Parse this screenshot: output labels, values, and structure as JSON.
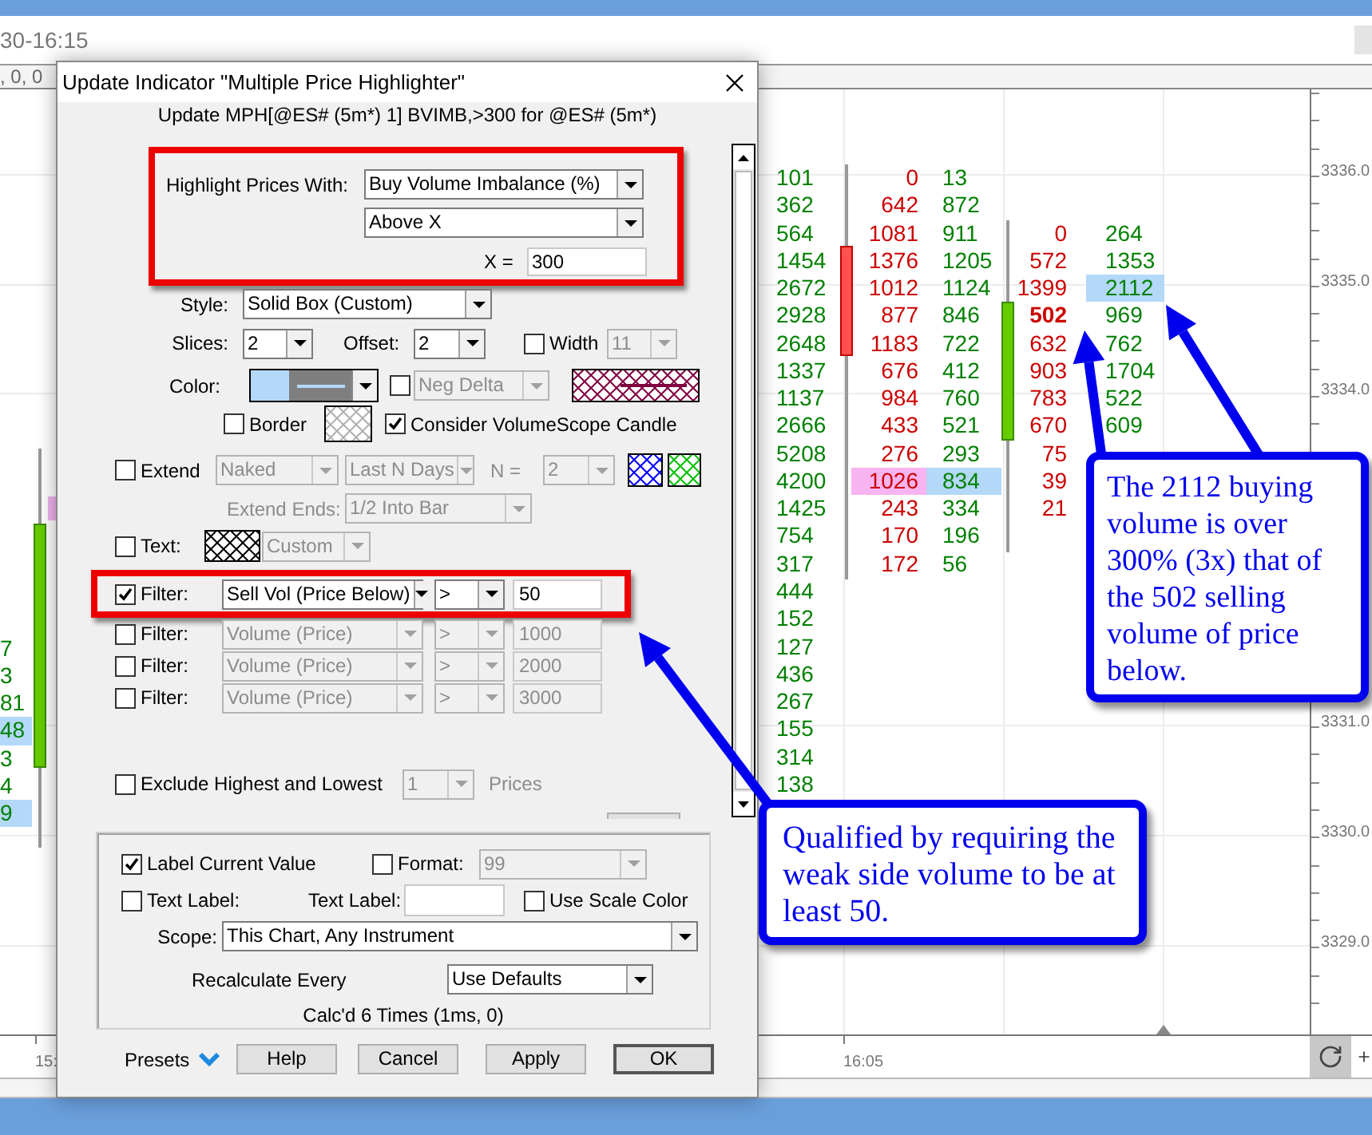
{
  "chart": {
    "range": "30-16:15",
    "status": ", 0, 0",
    "price_labels": [
      "3336.0",
      "3335.0",
      "3334.0",
      "3331.0",
      "3330.0",
      "3329.0"
    ],
    "time_labels": [
      "15:",
      "16:05"
    ],
    "left_cells": [
      {
        "text": "7",
        "highlighted": false
      },
      {
        "text": "3",
        "highlighted": false
      },
      {
        "text": "81",
        "highlighted": false
      },
      {
        "text": "48",
        "highlighted": true
      },
      {
        "text": "3",
        "highlighted": false
      },
      {
        "text": "4",
        "highlighted": false
      },
      {
        "text": "9",
        "highlighted": true
      }
    ],
    "volume_column": [
      "101",
      "362",
      "564",
      "1454",
      "2672",
      "2928",
      "2648",
      "1337",
      "1137",
      "2666",
      "5208",
      "4200",
      "1425",
      "754",
      "317",
      "444",
      "152",
      "127",
      "436",
      "267",
      "155",
      "314",
      "138"
    ],
    "footprints": [
      {
        "rows": [
          {
            "sell": "0",
            "buy": "13",
            "highlighted": false
          },
          {
            "sell": "642",
            "buy": "872",
            "highlighted": false
          },
          {
            "sell": "1081",
            "buy": "911",
            "highlighted": false
          },
          {
            "sell": "1376",
            "buy": "1205",
            "highlighted": false
          },
          {
            "sell": "1012",
            "buy": "1124",
            "highlighted": false
          },
          {
            "sell": "877",
            "buy": "846",
            "highlighted": false
          },
          {
            "sell": "1183",
            "buy": "722",
            "highlighted": false
          },
          {
            "sell": "676",
            "buy": "412",
            "highlighted": false
          },
          {
            "sell": "984",
            "buy": "760",
            "highlighted": false
          },
          {
            "sell": "433",
            "buy": "521",
            "highlighted": false
          },
          {
            "sell": "276",
            "buy": "293",
            "highlighted": false
          },
          {
            "sell": "1026",
            "buy": "834",
            "highlighted": true
          },
          {
            "sell": "243",
            "buy": "334",
            "highlighted": false
          },
          {
            "sell": "170",
            "buy": "196",
            "highlighted": false
          },
          {
            "sell": "172",
            "buy": "56",
            "highlighted": false
          }
        ],
        "rising": false
      },
      {
        "rows": [
          {
            "sell": "0",
            "buy": "264",
            "highlighted": false
          },
          {
            "sell": "572",
            "buy": "1353",
            "highlighted": false
          },
          {
            "sell": "1399",
            "buy": "2112",
            "highlighted": true
          },
          {
            "sell": "502",
            "buy": "969",
            "highlighted": false,
            "bold": true
          },
          {
            "sell": "632",
            "buy": "762",
            "highlighted": false
          },
          {
            "sell": "903",
            "buy": "1704",
            "highlighted": false
          },
          {
            "sell": "783",
            "buy": "522",
            "highlighted": false
          },
          {
            "sell": "670",
            "buy": "609",
            "highlighted": false
          },
          {
            "sell": "75",
            "highlighted": false
          },
          {
            "sell": "39",
            "highlighted": false
          },
          {
            "sell": "21",
            "highlighted": false
          }
        ],
        "rising": true
      }
    ]
  },
  "dialog": {
    "title": "Update Indicator \"Multiple Price Highlighter\"",
    "subtitle": "Update MPH[@ES# (5m*) 1] BVIMB,>300 for @ES# (5m*)",
    "highlight": {
      "annotated": true,
      "label": "Highlight Prices With:",
      "source": "Buy Volume Imbalance (%)",
      "condition": "Above X",
      "x_label": "X =",
      "x_value": "300"
    },
    "style": {
      "label": "Style:",
      "value": "Solid Box (Custom)"
    },
    "slices": {
      "label": "Slices:",
      "value": "2"
    },
    "offset": {
      "label": "Offset:",
      "value": "2"
    },
    "width": {
      "label": "Width",
      "checked": false,
      "value": "11",
      "disabled": true
    },
    "color": {
      "label": "Color:"
    },
    "neg_delta": {
      "checked": false,
      "value": "Neg Delta",
      "disabled": true
    },
    "border": {
      "label": "Border",
      "checked": false
    },
    "consider": {
      "label": "Consider VolumeScope Candle",
      "checked": true
    },
    "extend": {
      "label": "Extend",
      "checked": false,
      "mode": "Naked",
      "range": "Last N Days",
      "n_label": "N =",
      "n_value": "2",
      "disabled": true
    },
    "extend_ends": {
      "label": "Extend Ends:",
      "value": "1/2 Into Bar",
      "disabled": true
    },
    "text": {
      "label": "Text:",
      "checked": false,
      "value": "Custom",
      "disabled": true
    },
    "filters": [
      {
        "label": "Filter:",
        "checked": true,
        "field": "Sell Vol (Price Below)",
        "operator": ">",
        "value": "50",
        "disabled": false,
        "annotated": true
      },
      {
        "label": "Filter:",
        "checked": false,
        "field": "Volume (Price)",
        "operator": ">",
        "value": "1000",
        "disabled": true,
        "annotated": false
      },
      {
        "label": "Filter:",
        "checked": false,
        "field": "Volume (Price)",
        "operator": ">",
        "value": "2000",
        "disabled": true,
        "annotated": false
      },
      {
        "label": "Filter:",
        "checked": false,
        "field": "Volume (Price)",
        "operator": ">",
        "value": "3000",
        "disabled": true,
        "annotated": false
      }
    ],
    "exclude": {
      "label": "Exclude Highest and Lowest",
      "checked": false,
      "value": "1",
      "unit": "Prices",
      "disabled": true
    },
    "label_current_value": {
      "label": "Label Current Value",
      "checked": true
    },
    "format": {
      "label": "Format:",
      "checked": false,
      "value": "99",
      "disabled": true
    },
    "text_label": {
      "label": "Text Label:",
      "checked": false,
      "field_label": "Text Label:"
    },
    "use_scale_color": {
      "label": "Use Scale Color",
      "checked": false
    },
    "scope": {
      "label": "Scope:",
      "value": "This Chart, Any Instrument"
    },
    "recalculate": {
      "label": "Recalculate Every",
      "value": "Use Defaults"
    },
    "calc_status": "Calc'd 6 Times (1ms, 0)",
    "presets": "Presets",
    "buttons": [
      {
        "label": "Help",
        "default": false
      },
      {
        "label": "Cancel",
        "default": false
      },
      {
        "label": "Apply",
        "default": false
      },
      {
        "label": "OK",
        "default": true
      }
    ]
  },
  "callouts": [
    {
      "text": "The 2112 buying volume is over 300% (3x) that of the 502 selling volume of price below."
    },
    {
      "text": "Qualified by requiring the weak side volume to be at least 50."
    }
  ]
}
